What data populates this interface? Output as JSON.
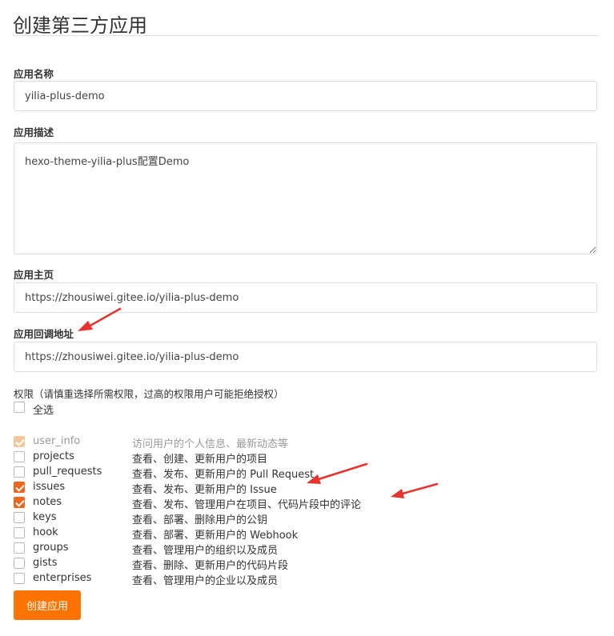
{
  "page_title": "创建第三方应用",
  "fields": {
    "name": {
      "label": "应用名称",
      "value": "yilia-plus-demo"
    },
    "description": {
      "label": "应用描述",
      "value": "hexo-theme-yilia-plus配置Demo"
    },
    "homepage": {
      "label": "应用主页",
      "value": "https://zhousiwei.gitee.io/yilia-plus-demo"
    },
    "callback": {
      "label": "应用回调地址",
      "value": "https://zhousiwei.gitee.io/yilia-plus-demo"
    }
  },
  "permissions": {
    "title": "权限（请慎重选择所需权限，过高的权限用户可能拒绝授权）",
    "select_all_label": "全选",
    "scopes": [
      {
        "name": "user_info",
        "desc": "访问用户的个人信息、最新动态等",
        "state": "checked-disabled"
      },
      {
        "name": "projects",
        "desc": "查看、创建、更新用户的项目",
        "state": "unchecked"
      },
      {
        "name": "pull_requests",
        "desc": "查看、发布、更新用户的 Pull Request",
        "state": "unchecked"
      },
      {
        "name": "issues",
        "desc": "查看、发布、更新用户的 Issue",
        "state": "checked"
      },
      {
        "name": "notes",
        "desc": "查看、发布、管理用户在项目、代码片段中的评论",
        "state": "checked"
      },
      {
        "name": "keys",
        "desc": "查看、部署、删除用户的公钥",
        "state": "unchecked"
      },
      {
        "name": "hook",
        "desc": "查看、部署、更新用户的 Webhook",
        "state": "unchecked"
      },
      {
        "name": "groups",
        "desc": "查看、管理用户的组织以及成员",
        "state": "unchecked"
      },
      {
        "name": "gists",
        "desc": "查看、删除、更新用户的代码片段",
        "state": "unchecked"
      },
      {
        "name": "enterprises",
        "desc": "查看、管理用户的企业以及成员",
        "state": "unchecked"
      }
    ]
  },
  "submit_label": "创建应用",
  "colors": {
    "accent": "#fe7300",
    "checkbox": "#f0661c",
    "annotation_arrow": "#e8322e"
  }
}
